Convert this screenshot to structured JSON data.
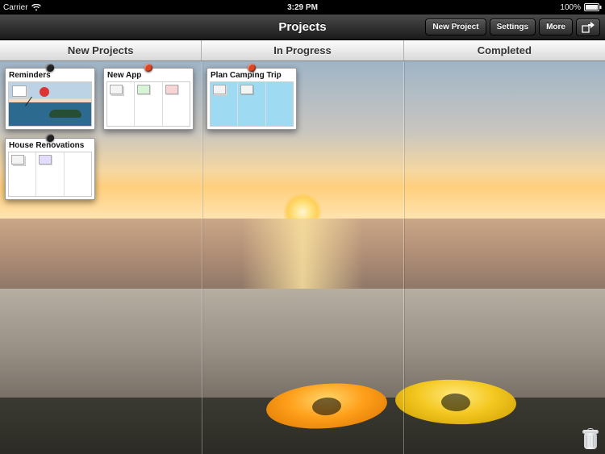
{
  "status": {
    "carrier": "Carrier",
    "time": "3:29 PM",
    "battery": "100%"
  },
  "nav": {
    "title": "Projects",
    "new_project": "New Project",
    "settings": "Settings",
    "more": "More"
  },
  "columns": [
    {
      "title": "New Projects"
    },
    {
      "title": "In Progress"
    },
    {
      "title": "Completed"
    }
  ],
  "board": {
    "new_projects": [
      {
        "title": "Reminders",
        "pin": "black",
        "thumb": "photo"
      },
      {
        "title": "New App",
        "pin": "red",
        "thumb": "kanban"
      },
      {
        "title": "House Renovations",
        "pin": "black",
        "thumb": "kanban2"
      }
    ],
    "in_progress": [
      {
        "title": "Plan Camping Trip",
        "pin": "red",
        "thumb": "camping"
      }
    ],
    "completed": []
  }
}
